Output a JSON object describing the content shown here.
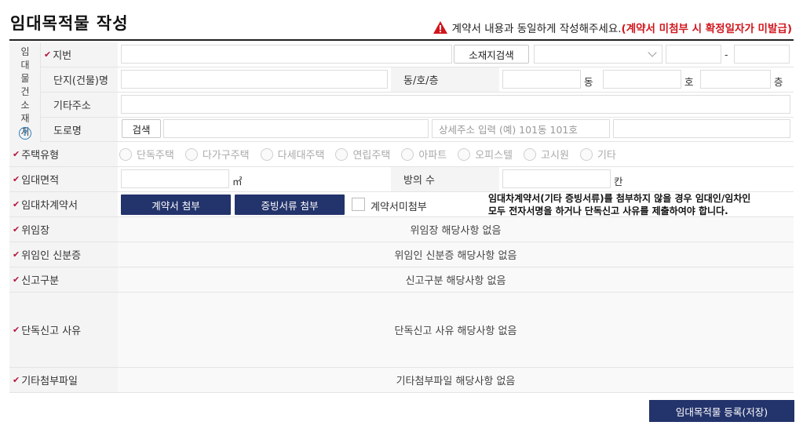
{
  "header": {
    "title": "임대목적물 작성",
    "notice_main": "계약서 내용과 동일하게 작성해주세요.",
    "notice_open": "(",
    "notice_red": "계약서 미첨부 시 확정일자가 미발급",
    "notice_close": ")"
  },
  "address_group": {
    "side_label": "임대물건소재지",
    "lot_label": "지번",
    "lot_search_button": "소재지검색",
    "lot_dash": "-",
    "complex_label": "단지(건물)명",
    "dong_ho_floor_label": "동/호/층",
    "dong_unit": "동",
    "ho_unit": "호",
    "floor_unit": "층",
    "etc_label": "기타주소",
    "road_label": "도로명",
    "road_search_button": "검색",
    "detail_placeholder": "상세주소 입력 (예) 101동 101호"
  },
  "housing_type": {
    "label": "주택유형",
    "options": [
      "단독주택",
      "다가구주택",
      "다세대주택",
      "연립주택",
      "아파트",
      "오피스텔",
      "고시원",
      "기타"
    ]
  },
  "area": {
    "label": "임대면적",
    "area_unit": "㎡",
    "rooms_label": "방의 수",
    "rooms_unit": "칸"
  },
  "contract": {
    "label": "임대차계약서",
    "attach_contract_button": "계약서 첨부",
    "attach_evidence_button": "증빙서류 첨부",
    "no_contract_label": "계약서미첨부",
    "note_line1": "임대차계약서(기타 증빙서류)를 첨부하지 않을 경우 임대인/임차인",
    "note_line2": "모두 전자서명을 하거나 단독신고 사유를 제출하여야 합니다."
  },
  "rows": {
    "delegation_label": "위임장",
    "delegation_value": "위임장 해당사항 없음",
    "delegate_id_label": "위임인 신분증",
    "delegate_id_value": "위임인 신분증 해당사항 없음",
    "report_type_label": "신고구분",
    "report_type_value": "신고구분 해당사항 없음",
    "sole_reason_label": "단독신고 사유",
    "sole_reason_value": "단독신고 사유 해당사항 없음",
    "other_files_label": "기타첨부파일",
    "other_files_value": "기타첨부파일 해당사항 없음"
  },
  "submit_button": "임대목적물 등록(저장)",
  "colors": {
    "accent": "#23336b",
    "warning": "#d0161d",
    "required_mark": "#b3163c"
  }
}
